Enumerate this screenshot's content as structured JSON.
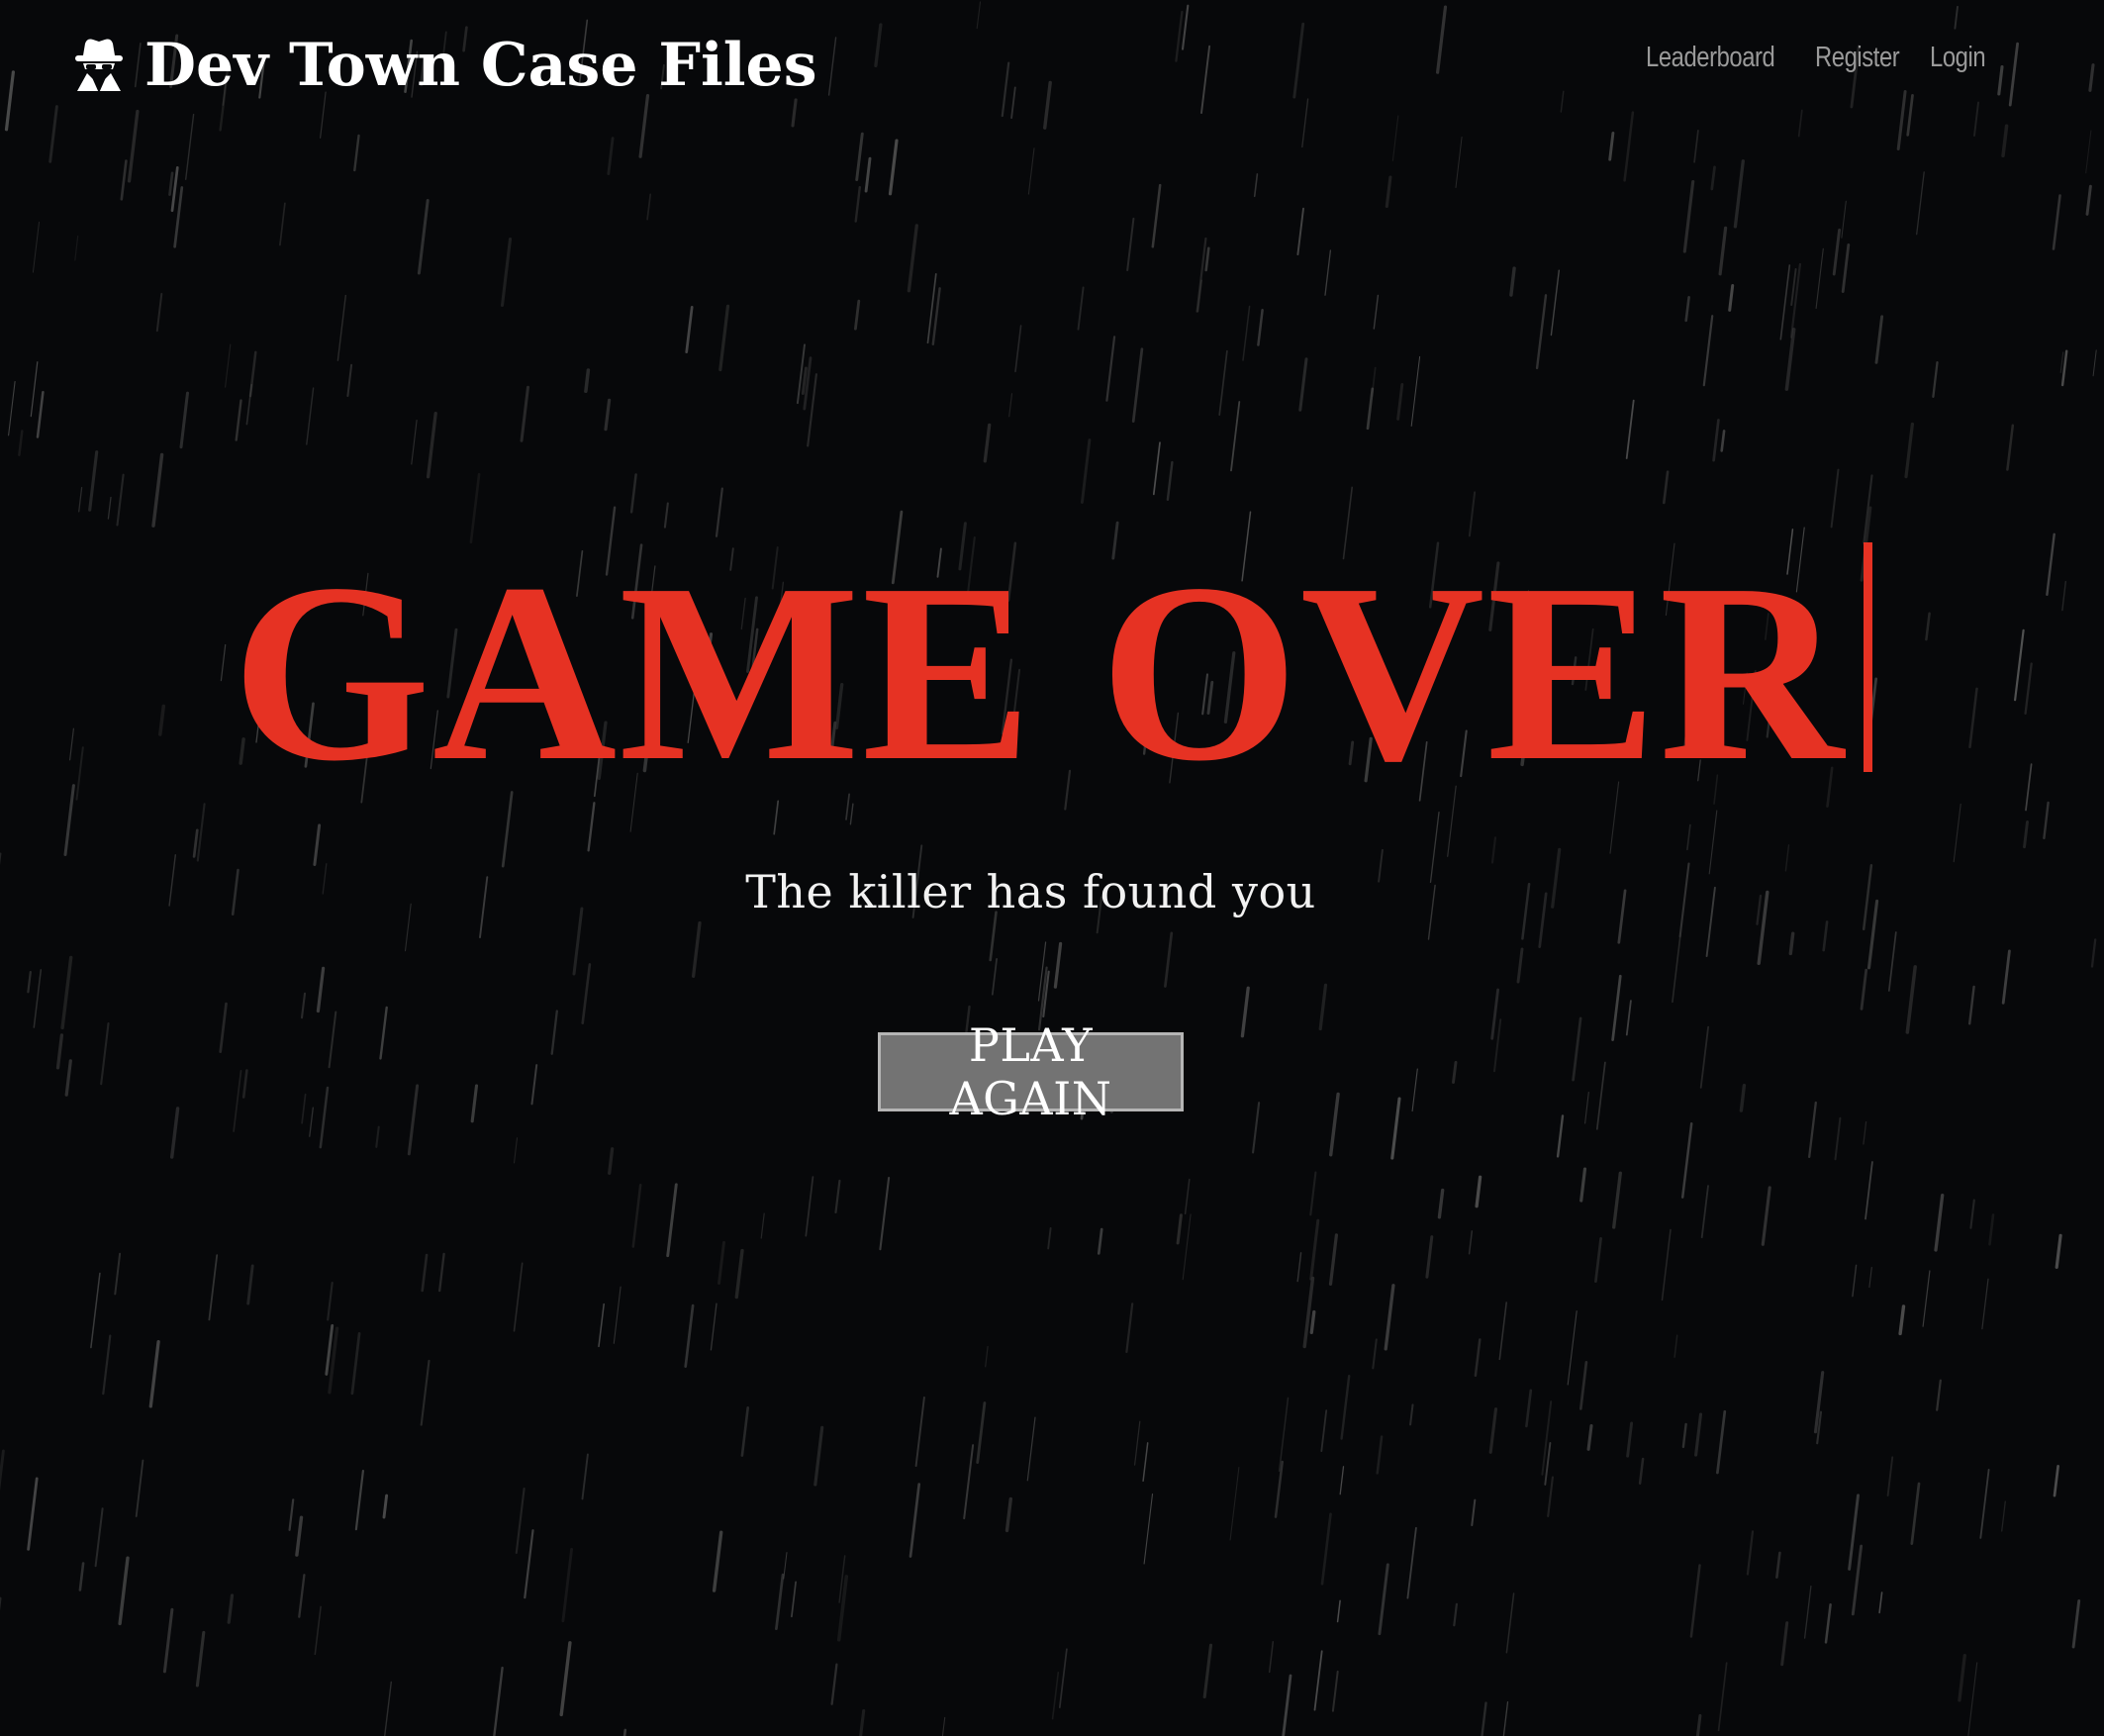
{
  "nav": {
    "brand_title": "Dev Town Case Files",
    "brand_icon": "detective-icon",
    "links": [
      {
        "label": "Leaderboard"
      },
      {
        "label": "Register"
      },
      {
        "label": "Login"
      }
    ]
  },
  "hero": {
    "title": "GAME OVER",
    "subtitle": "The killer has found you",
    "button_label": "PLAY AGAIN"
  },
  "colors": {
    "background": "#07080a",
    "title_red": "#e63223",
    "button_bg": "#737373",
    "nav_link": "#9a9a9a"
  }
}
